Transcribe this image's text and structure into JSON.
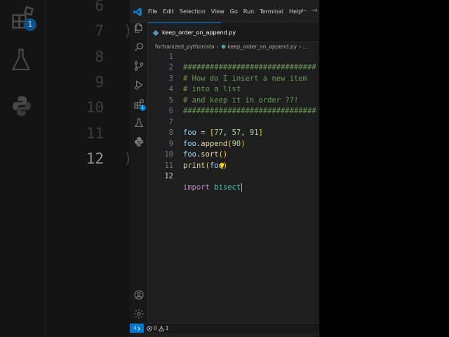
{
  "background": {
    "line_numbers": [
      "6",
      "7",
      "8",
      "9",
      "10",
      "11",
      "12"
    ],
    "badge_count": "1",
    "tail_glyph": ")"
  },
  "titlebar": {
    "menu": [
      "File",
      "Edit",
      "Selection",
      "View",
      "Go",
      "Run",
      "Terminal",
      "Help"
    ],
    "back_glyph": "←",
    "forward_glyph": "→"
  },
  "activity_bar": {
    "items": [
      "files-icon",
      "search-icon",
      "source-control-icon",
      "run-debug-icon",
      "extensions-icon",
      "testing-icon",
      "python-icon"
    ],
    "extensions_badge": "1",
    "bottom": [
      "account-icon",
      "settings-gear-icon"
    ]
  },
  "tabs": [
    {
      "label": "keep_order_on_append.py",
      "active": true,
      "icon": "python-file-icon"
    }
  ],
  "breadcrumb": {
    "folder": "fortranized_pythonista",
    "separator": "›",
    "file": "keep_order_on_append.py",
    "trailing": "›  ..."
  },
  "editor": {
    "language": "python",
    "current_line": 12,
    "lines": [
      {
        "n": "1",
        "text": "##############################"
      },
      {
        "n": "2",
        "text": "# How do I insert a new item"
      },
      {
        "n": "3",
        "text": "# into a list"
      },
      {
        "n": "4",
        "text": "# and keep it in order ??!"
      },
      {
        "n": "5",
        "text": "##############################"
      },
      {
        "n": "6",
        "text": ""
      },
      {
        "n": "7",
        "text": "foo = [77, 57, 91]"
      },
      {
        "n": "8",
        "text": "foo.append(90)"
      },
      {
        "n": "9",
        "text": "foo.sort()"
      },
      {
        "n": "10",
        "text": "print(foo)"
      },
      {
        "n": "11",
        "text": ""
      },
      {
        "n": "12",
        "text": "import bisect"
      }
    ],
    "tokens": {
      "comment_border": "##############################",
      "comment_2": "# How do I insert a new item",
      "comment_3": "# into a list",
      "comment_4": "# and keep it in order ??!",
      "var": "foo",
      "assign": " = ",
      "open_bracket": "[",
      "close_bracket": "]",
      "n77": "77",
      "n57": "57",
      "n91": "91",
      "comma": ", ",
      "dot": ".",
      "fn_append": "append",
      "fn_sort": "sort",
      "fn_print": "print",
      "open_paren": "(",
      "close_paren": ")",
      "n90": "90",
      "kw_import": "import",
      "space": " ",
      "mod_bisect": "bisect"
    },
    "lightbulb_line": "11"
  },
  "statusbar": {
    "errors": "0",
    "warnings": "1"
  },
  "colors": {
    "editor_bg": "#1e1e1e",
    "accent": "#0078d4",
    "comment": "#6a9955",
    "keyword": "#c586c0",
    "function": "#dcdcaa",
    "variable": "#9cdcfe",
    "number": "#b5cea8",
    "module": "#4ec9b0"
  }
}
